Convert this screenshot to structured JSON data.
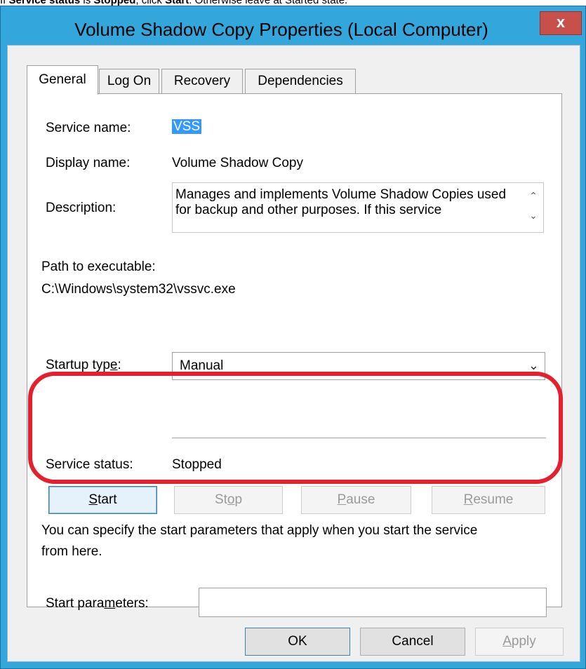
{
  "caption": {
    "p1": "If ",
    "b1": "Service status",
    "p2": " is ",
    "b2": "Stopped",
    "p3": ", click ",
    "b3": "Start",
    "p4": ". Otherwise leave at Started state."
  },
  "window": {
    "title": "Volume Shadow Copy Properties (Local Computer)",
    "close_label": "x"
  },
  "tabs": [
    {
      "label": "General",
      "active": true
    },
    {
      "label": "Log On",
      "active": false
    },
    {
      "label": "Recovery",
      "active": false
    },
    {
      "label": "Dependencies",
      "active": false
    }
  ],
  "general": {
    "service_name_label": "Service name:",
    "service_name_value": "VSS",
    "display_name_label": "Display name:",
    "display_name_value": "Volume Shadow Copy",
    "description_label": "Description:",
    "description_value": "Manages and implements Volume Shadow Copies used for backup and other purposes. If this service",
    "path_label": "Path to executable:",
    "path_value": "C:\\Windows\\system32\\vssvc.exe",
    "startup_type_label_pre": "Startup typ",
    "startup_type_label_u": "e",
    "startup_type_label_post": ":",
    "startup_type_value": "Manual",
    "service_status_label": "Service status:",
    "service_status_value": "Stopped",
    "start_label": "Start",
    "start_u": "S",
    "start_rest": "tart",
    "stop_label": "Stop",
    "stop_pre": "St",
    "stop_u": "o",
    "stop_post": "p",
    "pause_u": "P",
    "pause_rest": "ause",
    "resume_u": "R",
    "resume_rest": "esume",
    "info_text_line1": "You can specify the start parameters that apply when you start the service",
    "info_text_line2": "from here.",
    "start_params_label_pre": "Start para",
    "start_params_label_u": "m",
    "start_params_label_post": "eters:",
    "start_params_value": ""
  },
  "footer": {
    "ok_label": "OK",
    "cancel_label": "Cancel",
    "apply_u": "A",
    "apply_rest": "pply"
  },
  "colors": {
    "highlight": "#e5202e",
    "frame": "#33a7dc",
    "close": "#c7504a",
    "selection": "#3399ff"
  }
}
